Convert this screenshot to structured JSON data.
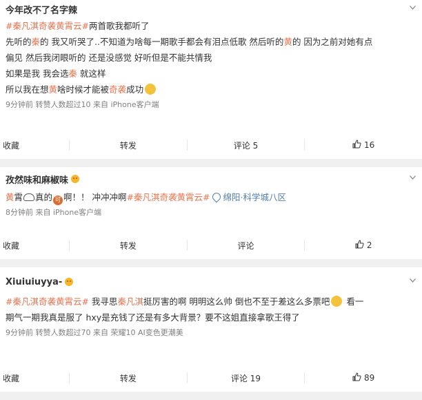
{
  "posts": [
    {
      "user": "今年改不了名字辣",
      "lines": [
        [
          {
            "t": "#秦凡淇奇袭黄霄云#",
            "c": "tag"
          },
          {
            "t": "两首歌我都听了",
            "c": ""
          }
        ],
        [
          {
            "t": "先听的",
            "c": ""
          },
          {
            "t": "秦",
            "c": "hl"
          },
          {
            "t": "的 我又听哭了..不知道为啥每一期歌手都会有泪点低歌 然后听的",
            "c": ""
          },
          {
            "t": "黄",
            "c": "hl"
          },
          {
            "t": "的 因为之前对她有点",
            "c": ""
          }
        ],
        [
          {
            "t": "偏见 然后我闭眼听的 还是没感觉 好听但是不能共情我",
            "c": ""
          }
        ],
        [
          {
            "t": "如果是我 我会选",
            "c": ""
          },
          {
            "t": "秦",
            "c": "hl"
          },
          {
            "t": " 就这样",
            "c": ""
          }
        ],
        [
          {
            "t": "所以我在想",
            "c": ""
          },
          {
            "t": "黄",
            "c": "hl"
          },
          {
            "t": "啥时候才能被",
            "c": ""
          },
          {
            "t": "奇袭",
            "c": "hl"
          },
          {
            "t": "成功",
            "c": ""
          }
        ]
      ],
      "meta": "9分钟前 转赞人数超过10  来自 iPhone客户端",
      "actions": {
        "fav": "收藏",
        "repost": "转发",
        "comment": "评论 5",
        "like": "16"
      }
    },
    {
      "user": "孜然味和麻椒味",
      "line_a": "黄",
      "line_b": "霄",
      "line_c": "真的",
      "line_d": "啊！！ 冲冲冲啊",
      "tag": "#秦凡淇奇袭黄霄云#",
      "location": "绵阳·科学城八区",
      "coin_glyph": "可",
      "meta": "8分钟前  来自 iPhone客户端",
      "actions": {
        "fav": "收藏",
        "repost": "转发",
        "comment": "评论",
        "like": "2"
      }
    },
    {
      "user": "Xiuiuiuyya-",
      "lines": [
        [
          {
            "t": "#秦凡淇奇袭黄霄云#",
            "c": "tag"
          },
          {
            "t": " 我寻思",
            "c": ""
          },
          {
            "t": "秦凡淇",
            "c": "hl"
          },
          {
            "t": "挺厉害的啊 明明这么帅 倒也不至于差这么多票吧",
            "c": ""
          },
          {
            "t": " 看一",
            "c": "emojiafter"
          }
        ],
        [
          {
            "t": "期气一期我真是服了 hxy是充钱了还是有多大背景？要不这姐直接拿歌王得了",
            "c": ""
          }
        ]
      ],
      "meta": "9分钟前 转赞人数超过70  来自 荣耀10 AI变色更潮美",
      "actions": {
        "fav": "收藏",
        "repost": "转发",
        "comment": "评论 19",
        "like": "89"
      }
    }
  ]
}
